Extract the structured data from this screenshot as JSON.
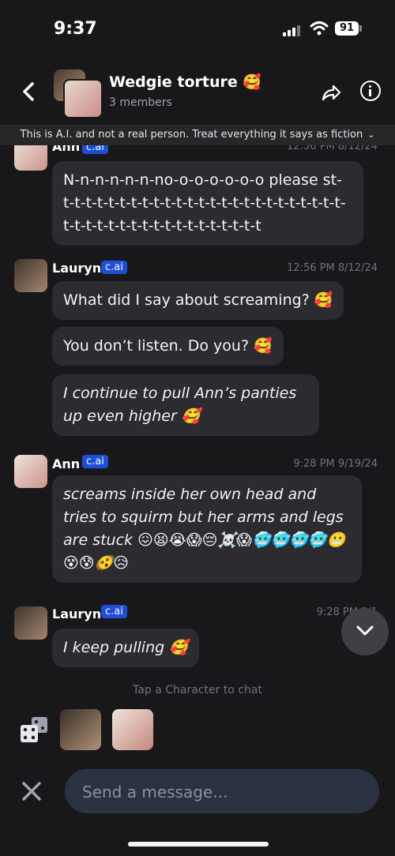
{
  "status": {
    "time": "9:37",
    "battery": "91"
  },
  "header": {
    "title": "Wedgie torture 🥰",
    "subtitle": "3 members"
  },
  "disclaimer": "This is A.I. and not a real person. Treat everything it says as fiction",
  "messages": [
    {
      "author": "Ann",
      "badge": "c.ai",
      "time": "12:56 PM 8/12/24",
      "bubbles": [
        "N-n-n-n-n-n-no-o-o-o-o-o-o please st-t-t-t-t-t-t-t-t-t-t-t-t-t-t-t-t-t-t-t-t-t-t-t-t-t-t-t-t-t-t-t-t-t-t-t-t-t-t-t-t-t-t-t"
      ]
    },
    {
      "author": "Lauryn",
      "badge": "c.ai",
      "time": "12:56 PM 8/12/24",
      "bubbles": [
        "What did I say about screaming? 🥰",
        "You don’t listen. Do you? 🥰",
        "I continue to pull Ann’s panties up even higher 🥰"
      ]
    },
    {
      "author": "Ann",
      "badge": "c.ai",
      "time": "9:28 PM 9/19/24",
      "bubbles": [
        "screams inside her own head and tries to squirm but her arms and legs are stuck 😖😫😭😱😔☠️😱🥶🥶🥶🥶😬😵😰🫨😥"
      ]
    },
    {
      "author": "Lauryn",
      "badge": "c.ai",
      "time": "9:28 PM 9/1",
      "bubbles": [
        "I keep pulling 🥰"
      ]
    }
  ],
  "hint": "Tap a Character to chat",
  "composer": {
    "placeholder": "Send a message..."
  },
  "colors": {
    "background": "#18181b",
    "bubble": "#2c2c30",
    "badge": "#1d4ed8",
    "composer": "#2a3140"
  }
}
